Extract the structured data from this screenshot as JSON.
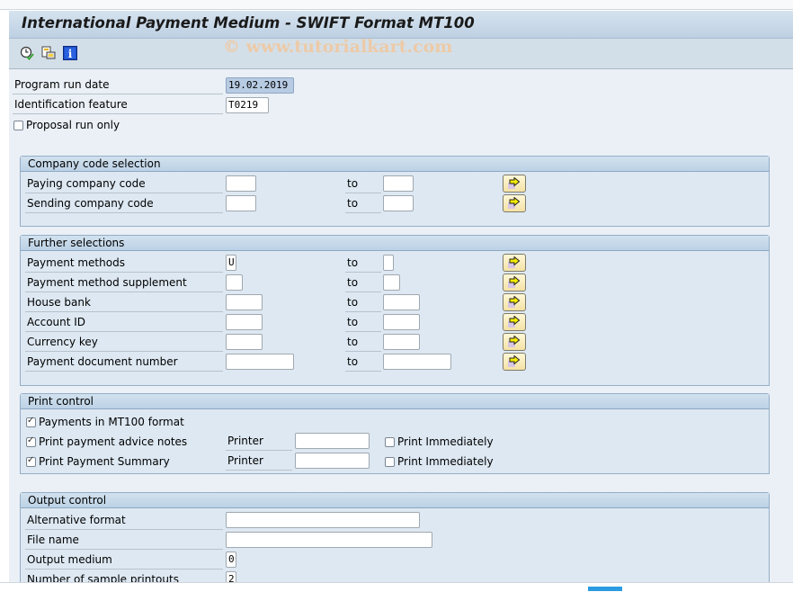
{
  "window": {
    "title": "International Payment Medium - SWIFT Format MT100",
    "watermark": "© www.tutorialkart.com"
  },
  "toolbar": {
    "buttons": [
      {
        "name": "execute",
        "icon": "clock-execute-icon"
      },
      {
        "name": "get-variant",
        "icon": "variant-icon"
      },
      {
        "name": "program-documentation",
        "icon": "info-icon"
      }
    ]
  },
  "header_fields": {
    "program_run_date": {
      "label": "Program run date",
      "value": "19.02.2019"
    },
    "identification_feature": {
      "label": "Identification feature",
      "value": "T0219"
    },
    "proposal_run_only": {
      "label": "Proposal run only",
      "checked": false
    }
  },
  "company_code_selection": {
    "title": "Company code selection",
    "to_label": "to",
    "rows": [
      {
        "label": "Paying company code",
        "from": "",
        "to": ""
      },
      {
        "label": "Sending company code",
        "from": "",
        "to": ""
      }
    ]
  },
  "further_selections": {
    "title": "Further selections",
    "to_label": "to",
    "rows": [
      {
        "label": "Payment methods",
        "from": "U",
        "to": ""
      },
      {
        "label": "Payment method supplement",
        "from": "",
        "to": ""
      },
      {
        "label": "House bank",
        "from": "",
        "to": ""
      },
      {
        "label": "Account ID",
        "from": "",
        "to": ""
      },
      {
        "label": "Currency key",
        "from": "",
        "to": ""
      },
      {
        "label": "Payment document number",
        "from": "",
        "to": ""
      }
    ]
  },
  "print_control": {
    "title": "Print control",
    "printer_label": "Printer",
    "print_immediately_label": "Print Immediately",
    "rows": [
      {
        "label": "Payments in MT100 format",
        "checked": true
      },
      {
        "label": "Print payment advice notes",
        "checked": true,
        "printer": "",
        "print_immediately": false
      },
      {
        "label": "Print Payment Summary",
        "checked": true,
        "printer": "",
        "print_immediately": false
      }
    ]
  },
  "output_control": {
    "title": "Output control",
    "rows": [
      {
        "label": "Alternative format",
        "value": ""
      },
      {
        "label": "File name",
        "value": ""
      },
      {
        "label": "Output medium",
        "value": "0"
      },
      {
        "label": "Number of sample printouts",
        "value": "2"
      }
    ]
  }
}
